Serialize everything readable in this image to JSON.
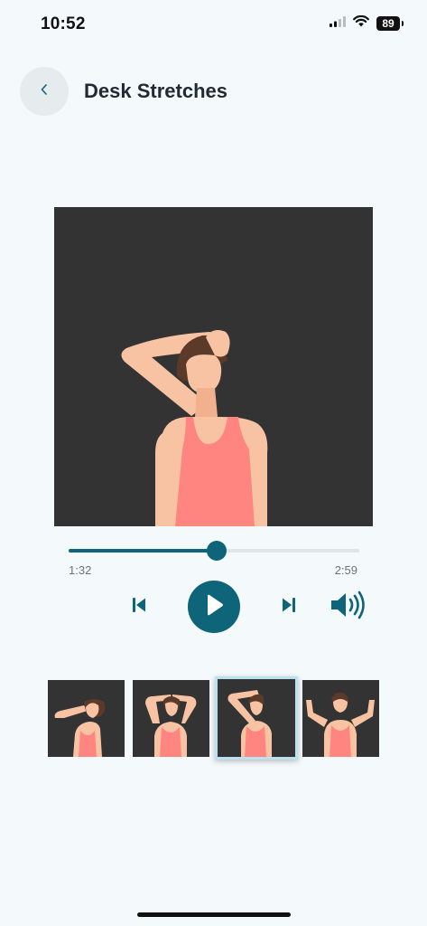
{
  "status_bar": {
    "time": "10:52",
    "battery_level": "89",
    "icons": [
      "cellular-signal-icon",
      "wifi-icon",
      "battery-icon"
    ]
  },
  "header": {
    "title": "Desk Stretches",
    "back_icon": "chevron-left-icon"
  },
  "player": {
    "current_time": "1:32",
    "duration": "2:59",
    "progress_fraction": 0.51,
    "controls": [
      "skip-previous-icon",
      "play-icon",
      "skip-next-icon",
      "volume-icon"
    ],
    "selected_thumbnail_index": 2,
    "thumbnail_count": 4
  },
  "colors": {
    "accent": "#0e6478",
    "background": "#f4f9fb",
    "video_background": "#333333",
    "selected_thumbnail_border": "#b9e1ef",
    "top_color": "#ff8580",
    "skin": "#f7c3a3",
    "hair": "#5b3a2a"
  }
}
